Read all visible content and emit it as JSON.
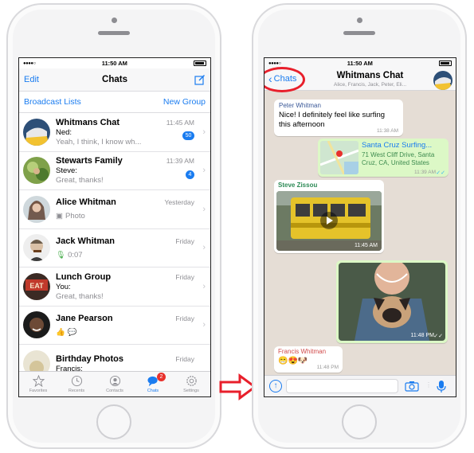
{
  "status": {
    "time": "11:50 AM",
    "signal": "●●●●○"
  },
  "chats_screen": {
    "nav": {
      "edit_label": "Edit",
      "title": "Chats"
    },
    "broadcast_label": "Broadcast Lists",
    "new_group_label": "New Group",
    "rows": [
      {
        "name": "Whitmans Chat",
        "time": "11:45 AM",
        "sender": "Ned:",
        "preview": "Yeah, I think, I know wh...",
        "badge": "50"
      },
      {
        "name": "Stewarts Family",
        "time": "11:39 AM",
        "sender": "Steve:",
        "preview": "Great, thanks!",
        "badge": "4"
      },
      {
        "name": "Alice Whitman",
        "time": "Yesterday",
        "sender": "",
        "preview": "Photo",
        "badge": ""
      },
      {
        "name": "Jack Whitman",
        "time": "Friday",
        "sender": "",
        "preview": "0:07",
        "badge": ""
      },
      {
        "name": "Lunch Group",
        "time": "Friday",
        "sender": "You:",
        "preview": "Great, thanks!",
        "badge": ""
      },
      {
        "name": "Jane Pearson",
        "time": "Friday",
        "sender": "",
        "preview": "",
        "badge": ""
      },
      {
        "name": "Birthday Photos",
        "time": "Friday",
        "sender": "Francis:",
        "preview": "",
        "badge": ""
      }
    ],
    "tabs": [
      {
        "label": "Favorites"
      },
      {
        "label": "Recents"
      },
      {
        "label": "Contacts"
      },
      {
        "label": "Chats",
        "badge": "2"
      },
      {
        "label": "Settings"
      }
    ]
  },
  "conversation": {
    "back_label": "Chats",
    "title": "Whitmans Chat",
    "members": "Alice, Francis, Jack, Peter, Eli...",
    "messages": {
      "peter": {
        "sender": "Peter Whitman",
        "text1": "Nice! I definitely feel like surfing",
        "text2": "this afternoon",
        "time": "11:38 AM"
      },
      "location": {
        "title": "Santa Cruz Surfing...",
        "address1": "71 West Cliff Drive, Santa",
        "address2": "Cruz, CA, United States",
        "time": "11:39 AM"
      },
      "steve": {
        "sender": "Steve Zissou",
        "time": "11:45 AM"
      },
      "dog_photo": {
        "time": "11:48 PM"
      },
      "francis": {
        "sender": "Francis Whitman",
        "emoji": "😁😍🐶",
        "time": "11:48 PM"
      }
    }
  },
  "colors": {
    "accent": "#1a7cf0",
    "bubble_out": "#dcf8c6",
    "wallpaper": "#e5ddd5",
    "highlight": "#e81f2b"
  }
}
